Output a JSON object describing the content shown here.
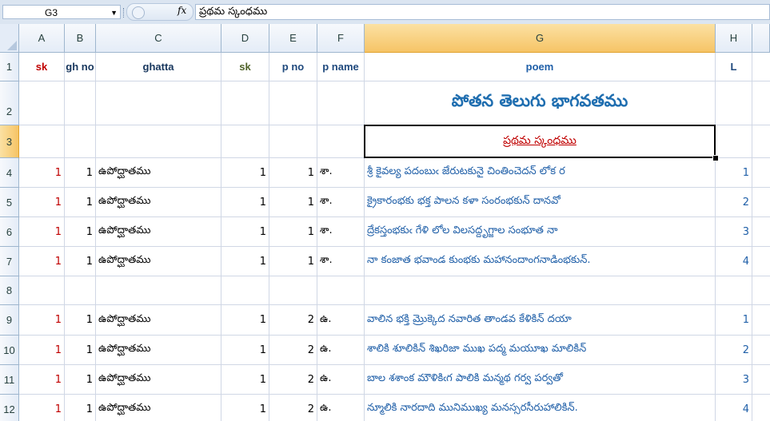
{
  "formula_bar": {
    "name_box": "G3",
    "dropdown_icon": "dropdown-arrow-icon",
    "fx_label": "fx",
    "formula": "ప్రథమ స్కంధము"
  },
  "columns": [
    {
      "letter": "A"
    },
    {
      "letter": "B"
    },
    {
      "letter": "C"
    },
    {
      "letter": "D"
    },
    {
      "letter": "E"
    },
    {
      "letter": "F"
    },
    {
      "letter": "G"
    },
    {
      "letter": "H"
    }
  ],
  "selected_cell": "G3",
  "header_row": {
    "row": "1",
    "A": "sk",
    "B": "gh no",
    "C": "ghatta",
    "D": "sk",
    "E": "p no",
    "F": "p name",
    "G": "poem",
    "H": "L"
  },
  "title_row": {
    "row": "2",
    "G": "పోతన తెలుగు భాగవతము"
  },
  "skandha_row": {
    "row": "3",
    "G": "ప్రథమ స్కంధము"
  },
  "rows": [
    {
      "row": "4",
      "A": "1",
      "B": "1",
      "C": "ఉపోద్ఘాతము",
      "D": "1",
      "E": "1",
      "F": "శా.",
      "G": "శ్రీ కైవల్య పదంబుఁ జేరుటకునై చింతించెదన్ లోక ర",
      "H": "1"
    },
    {
      "row": "5",
      "A": "1",
      "B": "1",
      "C": "ఉపోద్ఘాతము",
      "D": "1",
      "E": "1",
      "F": "శా.",
      "G": "క్రైకారంభకు భక్త పాలన కళా సంరంభకున్ దానవో",
      "H": "2"
    },
    {
      "row": "6",
      "A": "1",
      "B": "1",
      "C": "ఉపోద్ఘాతము",
      "D": "1",
      "E": "1",
      "F": "శా.",
      "G": "ద్రేకస్తంభకుఁ గేళి లోల విలసద్దృగ్జాల సంభూత నా",
      "H": "3"
    },
    {
      "row": "7",
      "A": "1",
      "B": "1",
      "C": "ఉపోద్ఘాతము",
      "D": "1",
      "E": "1",
      "F": "శా.",
      "G": "నా కంజాత భవాండ కుంభకు మహానందాంగనాడింభకున్.",
      "H": "4"
    },
    {
      "row": "8",
      "A": "",
      "B": "",
      "C": "",
      "D": "",
      "E": "",
      "F": "",
      "G": "",
      "H": ""
    },
    {
      "row": "9",
      "A": "1",
      "B": "1",
      "C": "ఉపోద్ఘాతము",
      "D": "1",
      "E": "2",
      "F": "ఉ.",
      "G": "వాలిన భక్తి మ్రొక్కెద నవారిత తాండవ కేళికిన్ దయా",
      "H": "1"
    },
    {
      "row": "10",
      "A": "1",
      "B": "1",
      "C": "ఉపోద్ఘాతము",
      "D": "1",
      "E": "2",
      "F": "ఉ.",
      "G": "శాలికి శూలికిన్ శిఖరిజా ముఖ పద్మ మయూఖ మాలికిన్",
      "H": "2"
    },
    {
      "row": "11",
      "A": "1",
      "B": "1",
      "C": "ఉపోద్ఘాతము",
      "D": "1",
      "E": "2",
      "F": "ఉ.",
      "G": "బాల శశాంక మౌళికిఁగ పాలికి మన్మథ గర్వ పర్వతో",
      "H": "3"
    },
    {
      "row": "12",
      "A": "1",
      "B": "1",
      "C": "ఉపోద్ఘాతము",
      "D": "1",
      "E": "2",
      "F": "ఉ.",
      "G": "న్మూలికి నారదాది మునిముఖ్య మనస్సరసీరుహాలికిన్.",
      "H": "4"
    }
  ]
}
